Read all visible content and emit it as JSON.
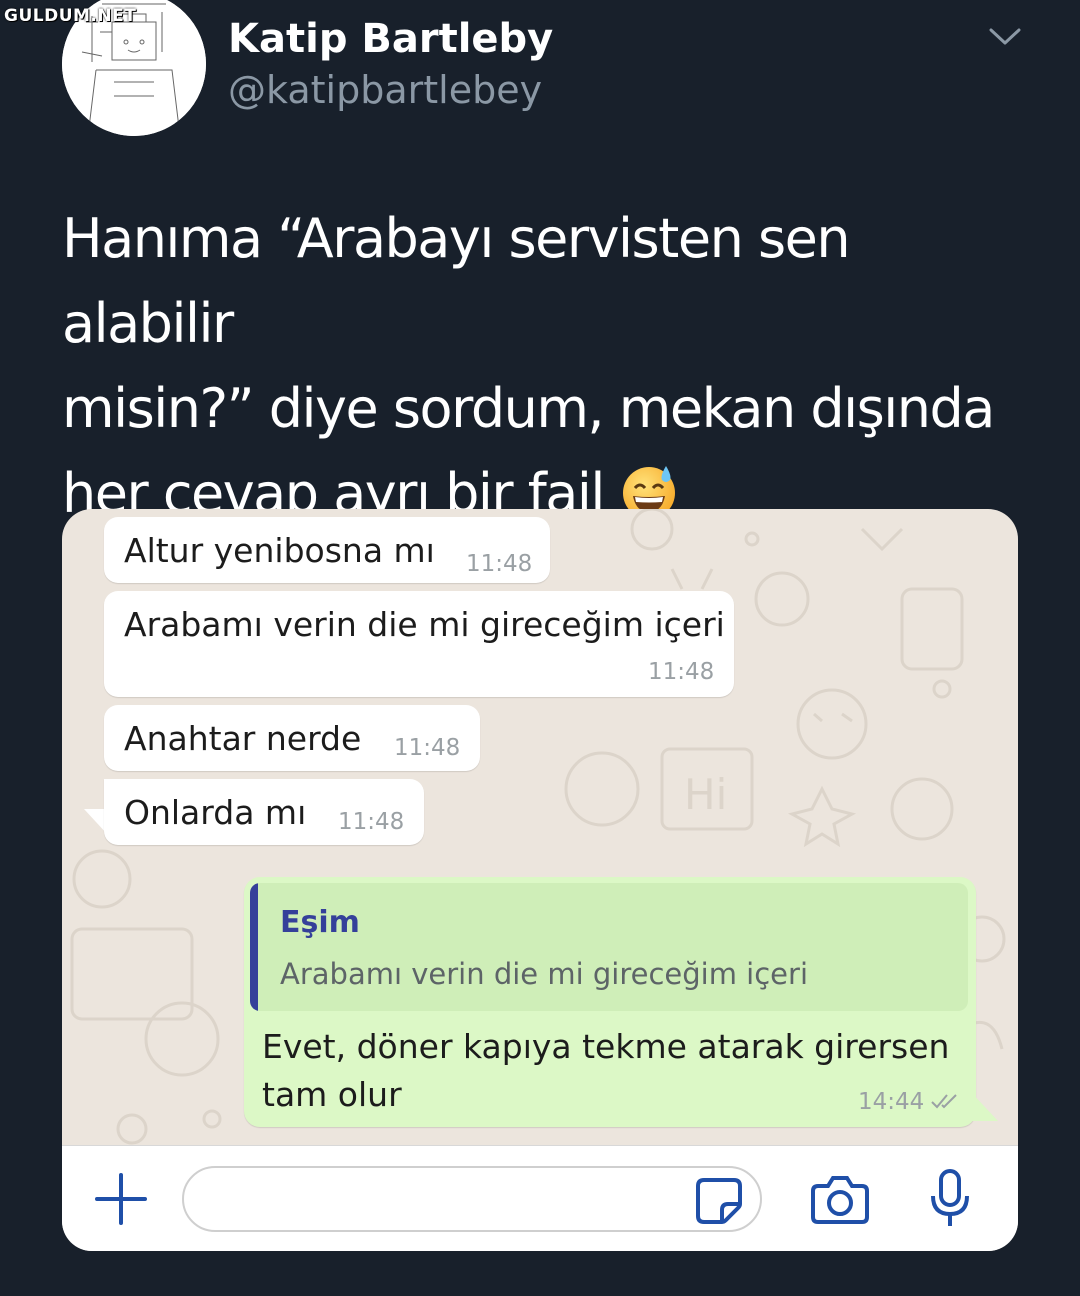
{
  "watermark": "GULDUM.NET",
  "tweet": {
    "display_name": "Katip Bartleby",
    "handle": "@katipbartlebey",
    "text_line1": "Hanıma “Arabayı servisten sen alabilir",
    "text_line2": "misin?” diye sordum, mekan dışında",
    "text_line3": "her cevap ayrı bir fail",
    "emoji_icon": "grinning-face-with-sweat"
  },
  "chat": {
    "incoming": [
      {
        "text": "Altur yenibosna mı",
        "time": "11:48"
      },
      {
        "text": "Arabamı verin die mi gireceğim içeri",
        "time": "11:48"
      },
      {
        "text": "Anahtar nerde",
        "time": "11:48"
      },
      {
        "text": "Onlarda mı",
        "time": "11:48"
      }
    ],
    "outgoing": {
      "quote_author": "Eşim",
      "quote_text": "Arabamı verin die mi gireceğim içeri",
      "text": "Evet, döner kapıya tekme atarak girersen tam olur",
      "time": "14:44"
    }
  },
  "colors": {
    "background": "#18202b",
    "incoming_bubble": "#ffffff",
    "outgoing_bubble": "#dcf8c6",
    "quote_accent": "#35409a",
    "icon_blue": "#1f4fa8"
  }
}
